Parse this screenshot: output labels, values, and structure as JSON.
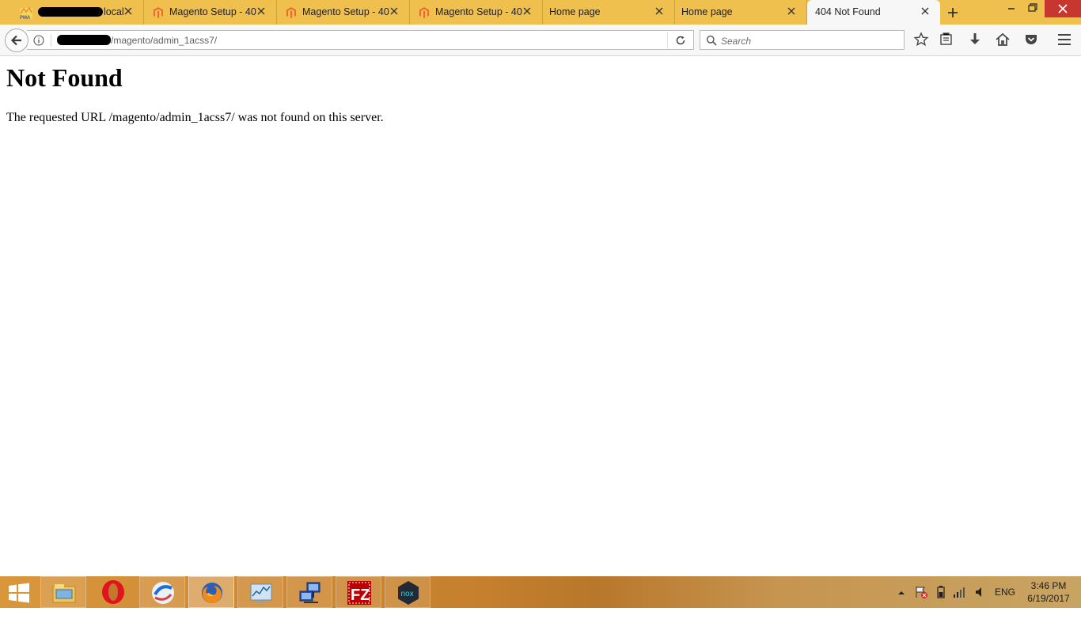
{
  "tabs": [
    {
      "title": "/ local",
      "icon": "phpmyadmin-icon",
      "active": false
    },
    {
      "title": "Magento Setup - 40",
      "icon": "magento-icon",
      "active": false
    },
    {
      "title": "Magento Setup - 40",
      "icon": "magento-icon",
      "active": false
    },
    {
      "title": "Magento Setup - 40",
      "icon": "magento-icon",
      "active": false
    },
    {
      "title": "Home page",
      "icon": "",
      "active": false
    },
    {
      "title": "Home page",
      "icon": "",
      "active": false
    },
    {
      "title": "404 Not Found",
      "icon": "",
      "active": true
    }
  ],
  "phpmyadmin_badge": "PMA",
  "navbar": {
    "url_path": "/magento/admin_1acss7/",
    "search_placeholder": "Search"
  },
  "page": {
    "heading": "Not Found",
    "message": "The requested URL /magento/admin_1acss7/ was not found on this server."
  },
  "taskbar": {
    "apps": [
      "start-icon",
      "file-explorer-icon",
      "opera-icon",
      "safari-like-browser-icon",
      "firefox-icon",
      "performance-monitor-icon",
      "network-tool-icon",
      "filezilla-icon",
      "nox-icon"
    ],
    "active_app": "firefox-icon",
    "filezilla_label": "FZ",
    "nox_label": "nox",
    "language": "ENG",
    "time": "3:46 PM",
    "date": "6/19/2017"
  },
  "colors": {
    "tabstrip": "#f0c04e",
    "active_tab": "#f7f7f7",
    "close_button": "#c7372f",
    "magento_orange": "#ee672f",
    "taskbar": "#c57f2d"
  }
}
